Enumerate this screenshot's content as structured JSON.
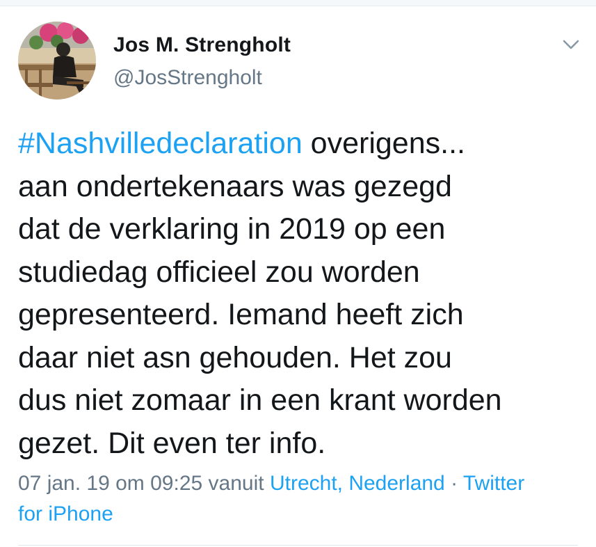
{
  "tweet": {
    "author": {
      "name": "Jos M. Strengholt",
      "handle": "@JosStrengholt"
    },
    "hashtag": "#Nashvilledeclaration",
    "lines": [
      " overigens...",
      "aan ondertekenaars was gezegd",
      "dat de verklaring in 2019 op een",
      "studiedag officieel zou worden",
      "gepresenteerd. Iemand heeft zich",
      "daar niet asn gehouden. Het zou",
      "dus niet zomaar in een krant worden",
      "gezet. Dit even ter info."
    ],
    "meta": {
      "timestamp": "07 jan. 19 om 09:25",
      "via_word": "vanuit",
      "location": "Utrecht, Nederland",
      "separator": "·",
      "source_part1": "Twitter",
      "source_part2": "for iPhone"
    }
  },
  "icons": {
    "menu": "chevron-down-icon"
  },
  "colors": {
    "text": "#14171a",
    "secondary": "#657786",
    "link": "#1da1f2",
    "divider": "#e1e8ed"
  }
}
